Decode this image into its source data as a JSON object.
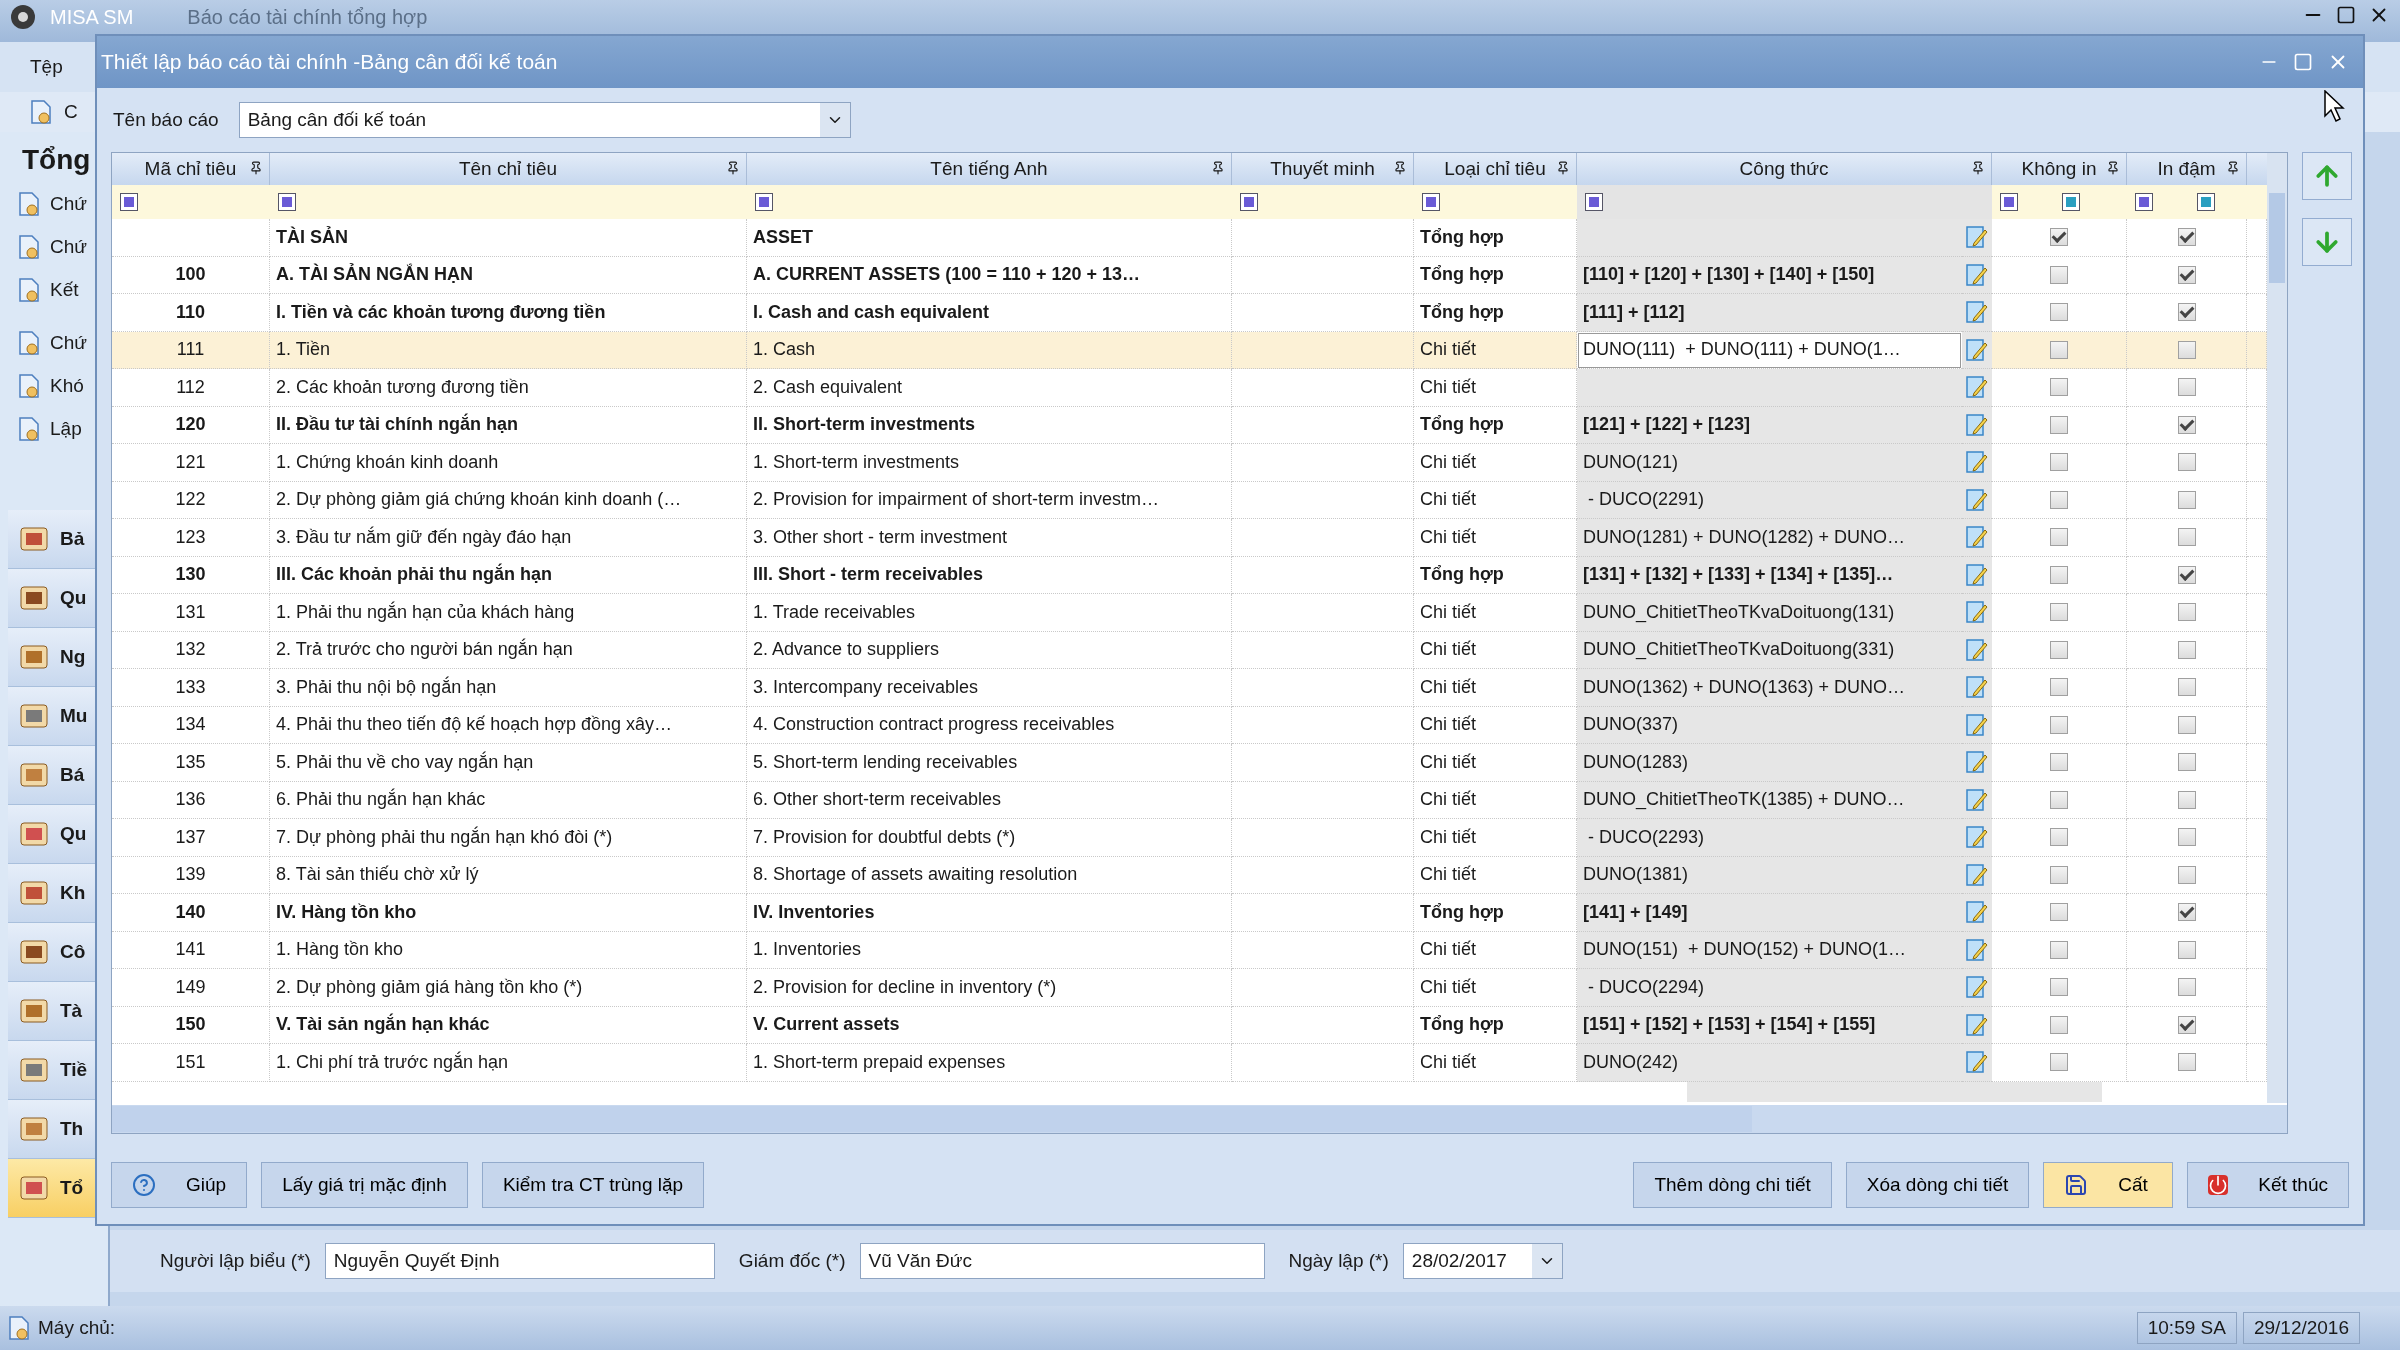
{
  "app": {
    "title": "MISA SM",
    "document_tab": "Báo cáo tài chính tổng hợp",
    "menu": [
      "Tệp"
    ],
    "toolbar_label": "C",
    "sidebar_heading": "Tổng",
    "sidebar_items": [
      "Chứ",
      "Chứ",
      "Kết",
      "Chứ",
      "Khó",
      "Lập"
    ],
    "modules": [
      {
        "label": "Bả",
        "selected": false
      },
      {
        "label": "Qu",
        "selected": false
      },
      {
        "label": "Ng",
        "selected": false
      },
      {
        "label": "Mu",
        "selected": false
      },
      {
        "label": "Bá",
        "selected": false
      },
      {
        "label": "Qu",
        "selected": false
      },
      {
        "label": "Kh",
        "selected": false
      },
      {
        "label": "Cô",
        "selected": false
      },
      {
        "label": "Tà",
        "selected": false
      },
      {
        "label": "Tiề",
        "selected": false
      },
      {
        "label": "Th",
        "selected": false
      },
      {
        "label": "Tổ",
        "selected": true
      }
    ],
    "footer_fields": [
      {
        "label": "Người lập biểu (*)",
        "value": "Nguyễn Quyết Định",
        "kind": "text"
      },
      {
        "label": "Giám đốc (*)",
        "value": "Vũ Văn Đức",
        "kind": "text"
      },
      {
        "label": "Ngày lập (*)",
        "value": "28/02/2017",
        "kind": "date"
      }
    ],
    "status_bar": {
      "server": "Máy chủ:",
      "time": "10:59 SA",
      "date": "29/12/2016"
    }
  },
  "dialog": {
    "title": "Thiết lập báo cáo tài chính -Bảng cân đối kế toán",
    "report_name": {
      "label": "Tên báo cáo",
      "value": "Bảng cân đối kế toán"
    },
    "columns": [
      "Mã chỉ tiêu",
      "Tên chỉ tiêu",
      "Tên tiếng Anh",
      "Thuyết minh",
      "Loại chỉ tiêu",
      "Công thức",
      "Không in",
      "In đậm"
    ],
    "rows": [
      {
        "code": "",
        "name": "TÀI SẢN",
        "name_en": "ASSET",
        "type": "Tổng hợp",
        "formula": "",
        "hidden": true,
        "bold": true,
        "selected": false
      },
      {
        "code": "100",
        "name": "A. TÀI SẢN NGẮN HẠN",
        "name_en": "A. CURRENT ASSETS (100 = 110 + 120 + 13…",
        "type": "Tổng hợp",
        "formula": "[110] + [120] + [130] + [140] + [150]",
        "hidden": false,
        "bold": true,
        "selected": false
      },
      {
        "code": "110",
        "name": "I. Tiền và các khoản tương đương tiền",
        "name_en": "I. Cash and cash equivalent",
        "type": "Tổng hợp",
        "formula": "[111] + [112]",
        "hidden": false,
        "bold": true,
        "selected": false
      },
      {
        "code": "111",
        "name": "1. Tiền",
        "name_en": "1. Cash",
        "type": "Chi tiết",
        "formula": "DUNO(111)  + DUNO(111) + DUNO(1…",
        "hidden": false,
        "bold": false,
        "selected": true
      },
      {
        "code": "112",
        "name": "2. Các khoản tương đương tiền",
        "name_en": "2. Cash equivalent",
        "type": "Chi tiết",
        "formula": "",
        "hidden": false,
        "bold": false,
        "selected": false
      },
      {
        "code": "120",
        "name": "II. Đầu tư tài chính ngắn hạn",
        "name_en": "II. Short-term investments",
        "type": "Tổng hợp",
        "formula": "[121] + [122] + [123]",
        "hidden": false,
        "bold": true,
        "selected": false
      },
      {
        "code": "121",
        "name": "1. Chứng khoán kinh doanh",
        "name_en": "1. Short-term investments",
        "type": "Chi tiết",
        "formula": "DUNO(121)",
        "hidden": false,
        "bold": false,
        "selected": false
      },
      {
        "code": "122",
        "name": "2. Dự phòng giảm giá chứng khoán kinh doanh (…",
        "name_en": "2. Provision for impairment of short-term investm…",
        "type": "Chi tiết",
        "formula": " - DUCO(2291)",
        "hidden": false,
        "bold": false,
        "selected": false
      },
      {
        "code": "123",
        "name": "3. Đầu tư nắm giữ đến ngày đáo hạn",
        "name_en": "3. Other short - term investment",
        "type": "Chi tiết",
        "formula": "DUNO(1281) + DUNO(1282) + DUNO…",
        "hidden": false,
        "bold": false,
        "selected": false
      },
      {
        "code": "130",
        "name": "III. Các khoản phải thu ngắn hạn",
        "name_en": "III. Short - term receivables",
        "type": "Tổng hợp",
        "formula": "[131] + [132] + [133] + [134] + [135]…",
        "hidden": false,
        "bold": true,
        "selected": false
      },
      {
        "code": "131",
        "name": "1. Phải thu ngắn hạn của khách hàng",
        "name_en": "1. Trade receivables",
        "type": "Chi tiết",
        "formula": "DUNO_ChitietTheoTKvaDoituong(131)",
        "hidden": false,
        "bold": false,
        "selected": false
      },
      {
        "code": "132",
        "name": "2. Trả trước cho người bán ngắn hạn",
        "name_en": "2. Advance to suppliers",
        "type": "Chi tiết",
        "formula": "DUNO_ChitietTheoTKvaDoituong(331)",
        "hidden": false,
        "bold": false,
        "selected": false
      },
      {
        "code": "133",
        "name": "3. Phải thu nội bộ ngắn hạn",
        "name_en": "3. Intercompany receivables",
        "type": "Chi tiết",
        "formula": "DUNO(1362) + DUNO(1363) + DUNO…",
        "hidden": false,
        "bold": false,
        "selected": false
      },
      {
        "code": "134",
        "name": "4. Phải thu theo tiến độ kế hoạch hợp đồng xây…",
        "name_en": "4. Construction contract progress receivables",
        "type": "Chi tiết",
        "formula": "DUNO(337)",
        "hidden": false,
        "bold": false,
        "selected": false
      },
      {
        "code": "135",
        "name": "5. Phải thu về cho vay ngắn hạn",
        "name_en": "5. Short-term lending receivables",
        "type": "Chi tiết",
        "formula": "DUNO(1283)",
        "hidden": false,
        "bold": false,
        "selected": false
      },
      {
        "code": "136",
        "name": "6. Phải thu ngắn hạn khác",
        "name_en": "6. Other short-term receivables",
        "type": "Chi tiết",
        "formula": "DUNO_ChitietTheoTK(1385) + DUNO…",
        "hidden": false,
        "bold": false,
        "selected": false
      },
      {
        "code": "137",
        "name": "7. Dự phòng phải thu ngắn hạn khó đòi (*)",
        "name_en": "7. Provision for doubtful debts (*)",
        "type": "Chi tiết",
        "formula": " - DUCO(2293)",
        "hidden": false,
        "bold": false,
        "selected": false
      },
      {
        "code": "139",
        "name": "8. Tài sản thiếu chờ xử lý",
        "name_en": "8. Shortage of assets awaiting resolution",
        "type": "Chi tiết",
        "formula": "DUNO(1381)",
        "hidden": false,
        "bold": false,
        "selected": false
      },
      {
        "code": "140",
        "name": "IV. Hàng tồn kho",
        "name_en": "IV. Inventories",
        "type": "Tổng hợp",
        "formula": "[141] + [149]",
        "hidden": false,
        "bold": true,
        "selected": false
      },
      {
        "code": "141",
        "name": "1. Hàng tồn kho",
        "name_en": "1. Inventories",
        "type": "Chi tiết",
        "formula": "DUNO(151)  + DUNO(152) + DUNO(1…",
        "hidden": false,
        "bold": false,
        "selected": false
      },
      {
        "code": "149",
        "name": "2. Dự phòng giảm giá hàng tồn kho (*)",
        "name_en": "2. Provision for decline in inventory (*)",
        "type": "Chi tiết",
        "formula": " - DUCO(2294)",
        "hidden": false,
        "bold": false,
        "selected": false
      },
      {
        "code": "150",
        "name": "V. Tài sản ngắn hạn khác",
        "name_en": "V. Current assets",
        "type": "Tổng hợp",
        "formula": "[151] + [152] + [153] + [154] + [155]",
        "hidden": false,
        "bold": true,
        "selected": false
      },
      {
        "code": "151",
        "name": "1. Chi phí trả trước ngắn hạn",
        "name_en": "1. Short-term prepaid expenses",
        "type": "Chi tiết",
        "formula": "DUNO(242)",
        "hidden": false,
        "bold": false,
        "selected": false
      }
    ],
    "buttons": [
      {
        "label": "Giúp",
        "kind": "help"
      },
      {
        "label": "Lấy giá trị mặc định",
        "kind": "plain"
      },
      {
        "label": "Kiểm tra CT trùng lặp",
        "kind": "plain"
      },
      {
        "label": "Thêm dòng chi tiết",
        "kind": "plain"
      },
      {
        "label": "Xóa dòng chi tiết",
        "kind": "plain"
      },
      {
        "label": "Cất",
        "kind": "save"
      },
      {
        "label": "Kết thúc",
        "kind": "exit"
      }
    ]
  }
}
